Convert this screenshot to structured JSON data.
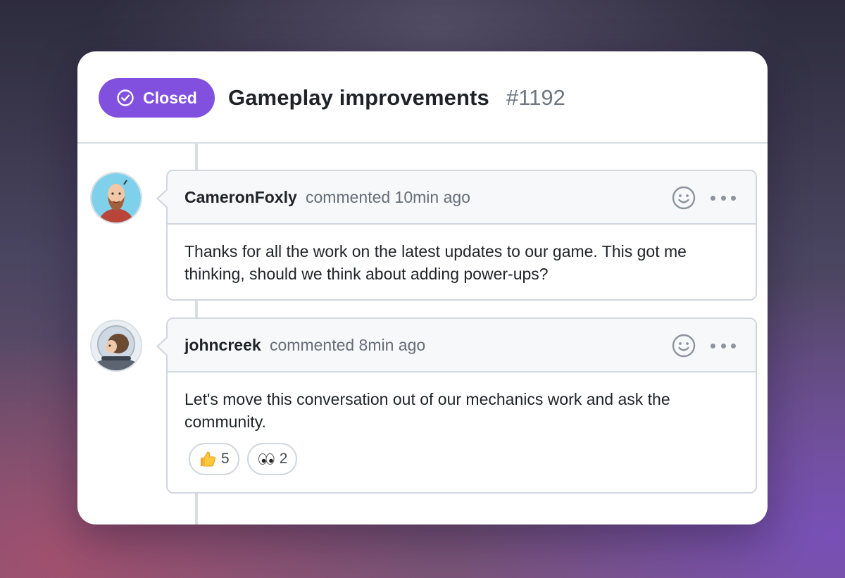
{
  "issue": {
    "status_label": "Closed",
    "status_icon": "check-circle-icon",
    "status_color": "#8250df",
    "title": "Gameplay improvements",
    "number": "#1192"
  },
  "comments": [
    {
      "author": "CameronFoxly",
      "meta": "commented 10min ago",
      "body": "Thanks for all the work on the latest updates to our game. This got me thinking, should we think about adding power-ups?",
      "avatar_icon": "bearded-man-avatar"
    },
    {
      "author": "johncreek",
      "meta": "commented 8min ago",
      "body": "Let's move this conversation out of our mechanics work and ask the community.",
      "avatar_icon": "astronaut-avatar",
      "reactions": [
        {
          "emoji": "thumbs-up",
          "count": "5"
        },
        {
          "emoji": "eyes",
          "count": "2"
        }
      ]
    }
  ]
}
